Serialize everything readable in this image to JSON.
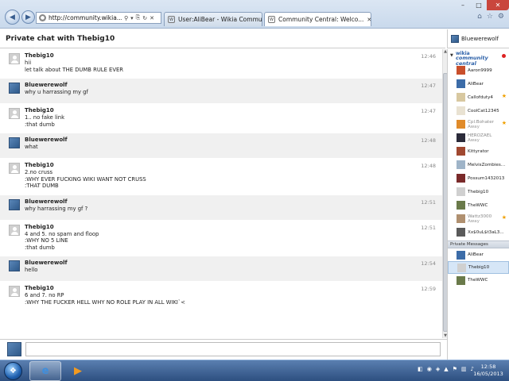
{
  "browser": {
    "url": "http://community.wikia....",
    "tabs": [
      {
        "title": "User:AliBear - Wikia Communi...",
        "active": false
      },
      {
        "title": "Community Central: Welco...",
        "active": true
      }
    ]
  },
  "chat": {
    "header_title": "Private chat with Thebig10",
    "current_user": "Bluewerewolf",
    "messages": [
      {
        "user": "Thebig10",
        "time": "12:46",
        "lines": [
          "hii",
          "let talk about THE DUMB RULE EVER"
        ],
        "avatar": "grey"
      },
      {
        "user": "Bluewerewolf",
        "time": "12:47",
        "lines": [
          "why u harrassing my gf"
        ],
        "avatar": "wolf"
      },
      {
        "user": "Thebig10",
        "time": "12:47",
        "lines": [
          "1.. no fake link",
          ":that dumb"
        ],
        "avatar": "grey"
      },
      {
        "user": "Bluewerewolf",
        "time": "12:48",
        "lines": [
          "what"
        ],
        "avatar": "wolf"
      },
      {
        "user": "Thebig10",
        "time": "12:48",
        "lines": [
          "2.no cruss",
          ":WHY EVER FUCKING WIKI WANT NOT CRUSS",
          ":THAT DUMB"
        ],
        "avatar": "grey"
      },
      {
        "user": "Bluewerewolf",
        "time": "12:51",
        "lines": [
          "why harrassing my gf ?"
        ],
        "avatar": "wolf"
      },
      {
        "user": "Thebig10",
        "time": "12:51",
        "lines": [
          "4 and 5. no spam and floop",
          ":WHY NO 5 LINE",
          ":that dumb"
        ],
        "avatar": "grey"
      },
      {
        "user": "Bluewerewolf",
        "time": "12:54",
        "lines": [
          "hello"
        ],
        "avatar": "wolf"
      },
      {
        "user": "Thebig10",
        "time": "12:59",
        "lines": [
          "6 and 7. no RP",
          ":WHY THE FUCKER HELL WHY NO ROLE PLAY IN ALL WIKI`<"
        ],
        "avatar": "grey"
      }
    ],
    "input_value": ""
  },
  "sidebar": {
    "logo_top": "wikia",
    "logo_bottom": "community central",
    "users": [
      {
        "name": "Aaron9999",
        "status": "",
        "color": "c1",
        "star": false
      },
      {
        "name": "AliBear",
        "status": "",
        "color": "c2",
        "star": false
      },
      {
        "name": "Callofduty4",
        "status": "",
        "color": "c3",
        "star": true
      },
      {
        "name": "CoolCat12345",
        "status": "",
        "color": "c4",
        "star": false
      },
      {
        "name": "Cpl.Bohater",
        "status": "Away",
        "color": "c5",
        "star": true
      },
      {
        "name": "HEROZAEL",
        "status": "Away",
        "color": "c6",
        "star": false
      },
      {
        "name": "Kittyrator",
        "status": "",
        "color": "c7",
        "star": false
      },
      {
        "name": "MelvisZombies...",
        "status": "",
        "color": "c8",
        "star": false
      },
      {
        "name": "Possum1432013",
        "status": "",
        "color": "c9",
        "star": false
      },
      {
        "name": "Thebig10",
        "status": "",
        "color": "c10",
        "star": false
      },
      {
        "name": "TheWWC",
        "status": "",
        "color": "c11",
        "star": false
      },
      {
        "name": "Wattz3000",
        "status": "Away",
        "color": "c12",
        "star": true
      },
      {
        "name": "Xx$0uL$t3aL3...",
        "status": "",
        "color": "c13",
        "star": false
      }
    ],
    "pm_header": "Private Messages",
    "private_messages": [
      {
        "name": "AliBear",
        "color": "c2",
        "selected": false
      },
      {
        "name": "Thebig10",
        "color": "c10",
        "selected": true
      },
      {
        "name": "TheWWC",
        "color": "c11",
        "selected": false
      }
    ]
  },
  "taskbar": {
    "time": "12:58",
    "date": "16/05/2013"
  }
}
